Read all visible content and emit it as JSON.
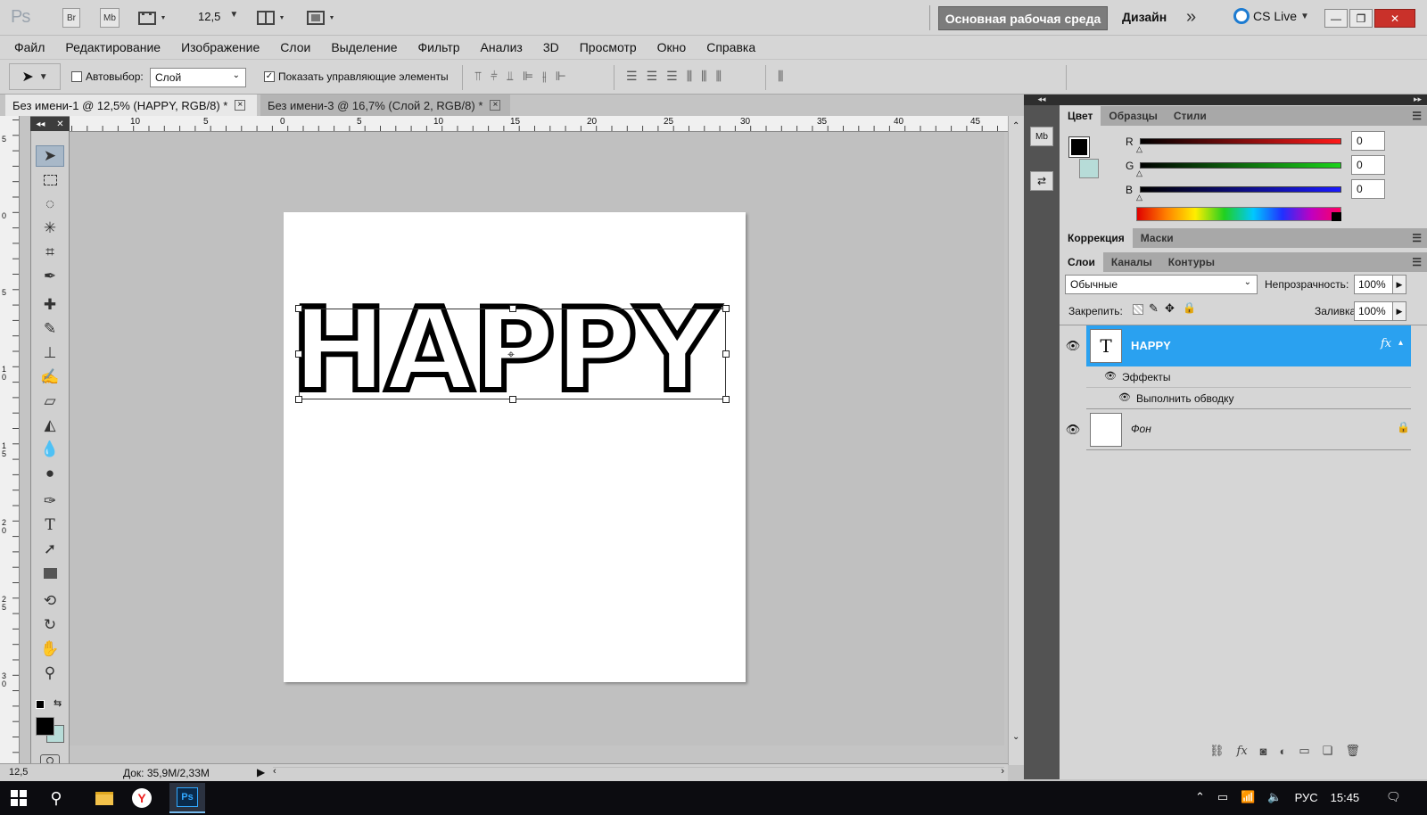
{
  "app": {
    "logo": "Ps",
    "bridge_btn": "Br",
    "minibridge_btn": "Mb",
    "zoom": "12,5",
    "workspace": "Основная рабочая среда",
    "design": "Дизайн",
    "more": "»",
    "cslive": "CS Live"
  },
  "menu": [
    "Файл",
    "Редактирование",
    "Изображение",
    "Слои",
    "Выделение",
    "Фильтр",
    "Анализ",
    "3D",
    "Просмотр",
    "Окно",
    "Справка"
  ],
  "options": {
    "autoselect_label": "Автовыбор:",
    "autoselect_value": "Слой",
    "show_controls_label": "Показать управляющие элементы"
  },
  "tabs": [
    {
      "label": "Без имени-1 @ 12,5% (HAPPY, RGB/8) *"
    },
    {
      "label": "Без имени-3 @ 16,7% (Слой 2, RGB/8) *"
    }
  ],
  "ruler": {
    "h": [
      "10",
      "5",
      "0",
      "5",
      "10",
      "15",
      "20",
      "25",
      "30",
      "35",
      "40",
      "45"
    ],
    "v": [
      "5",
      "0",
      "5",
      "10",
      "15",
      "20",
      "25",
      "30"
    ]
  },
  "canvas": {
    "text": "HAPPY"
  },
  "status": {
    "zoom": "12,5",
    "doc": "Док: 35,9M/2,33M"
  },
  "color_panel": {
    "tabs": [
      "Цвет",
      "Образцы",
      "Стили"
    ],
    "r_label": "R",
    "g_label": "G",
    "b_label": "B",
    "r": "0",
    "g": "0",
    "b": "0",
    "fg": "#000000",
    "bg": "#b7dcd8"
  },
  "adjust_panel": {
    "tabs": [
      "Коррекция",
      "Маски"
    ]
  },
  "layers_panel": {
    "tabs": [
      "Слои",
      "Каналы",
      "Контуры"
    ],
    "blend": "Обычные",
    "opacity_label": "Непрозрачность:",
    "opacity": "100%",
    "lock_label": "Закрепить:",
    "fill_label": "Заливка:",
    "fill": "100%",
    "layers": [
      {
        "name": "HAPPY",
        "type_glyph": "T",
        "fx": "fx",
        "effects": "Эффекты",
        "stroke": "Выполнить обводку"
      },
      {
        "name": "Фон"
      }
    ]
  },
  "taskbar": {
    "lang": "РУС",
    "time": "15:45"
  },
  "colors": {
    "selected_layer": "#2aa1f0",
    "workspace_btn": "#7c7c7c"
  }
}
